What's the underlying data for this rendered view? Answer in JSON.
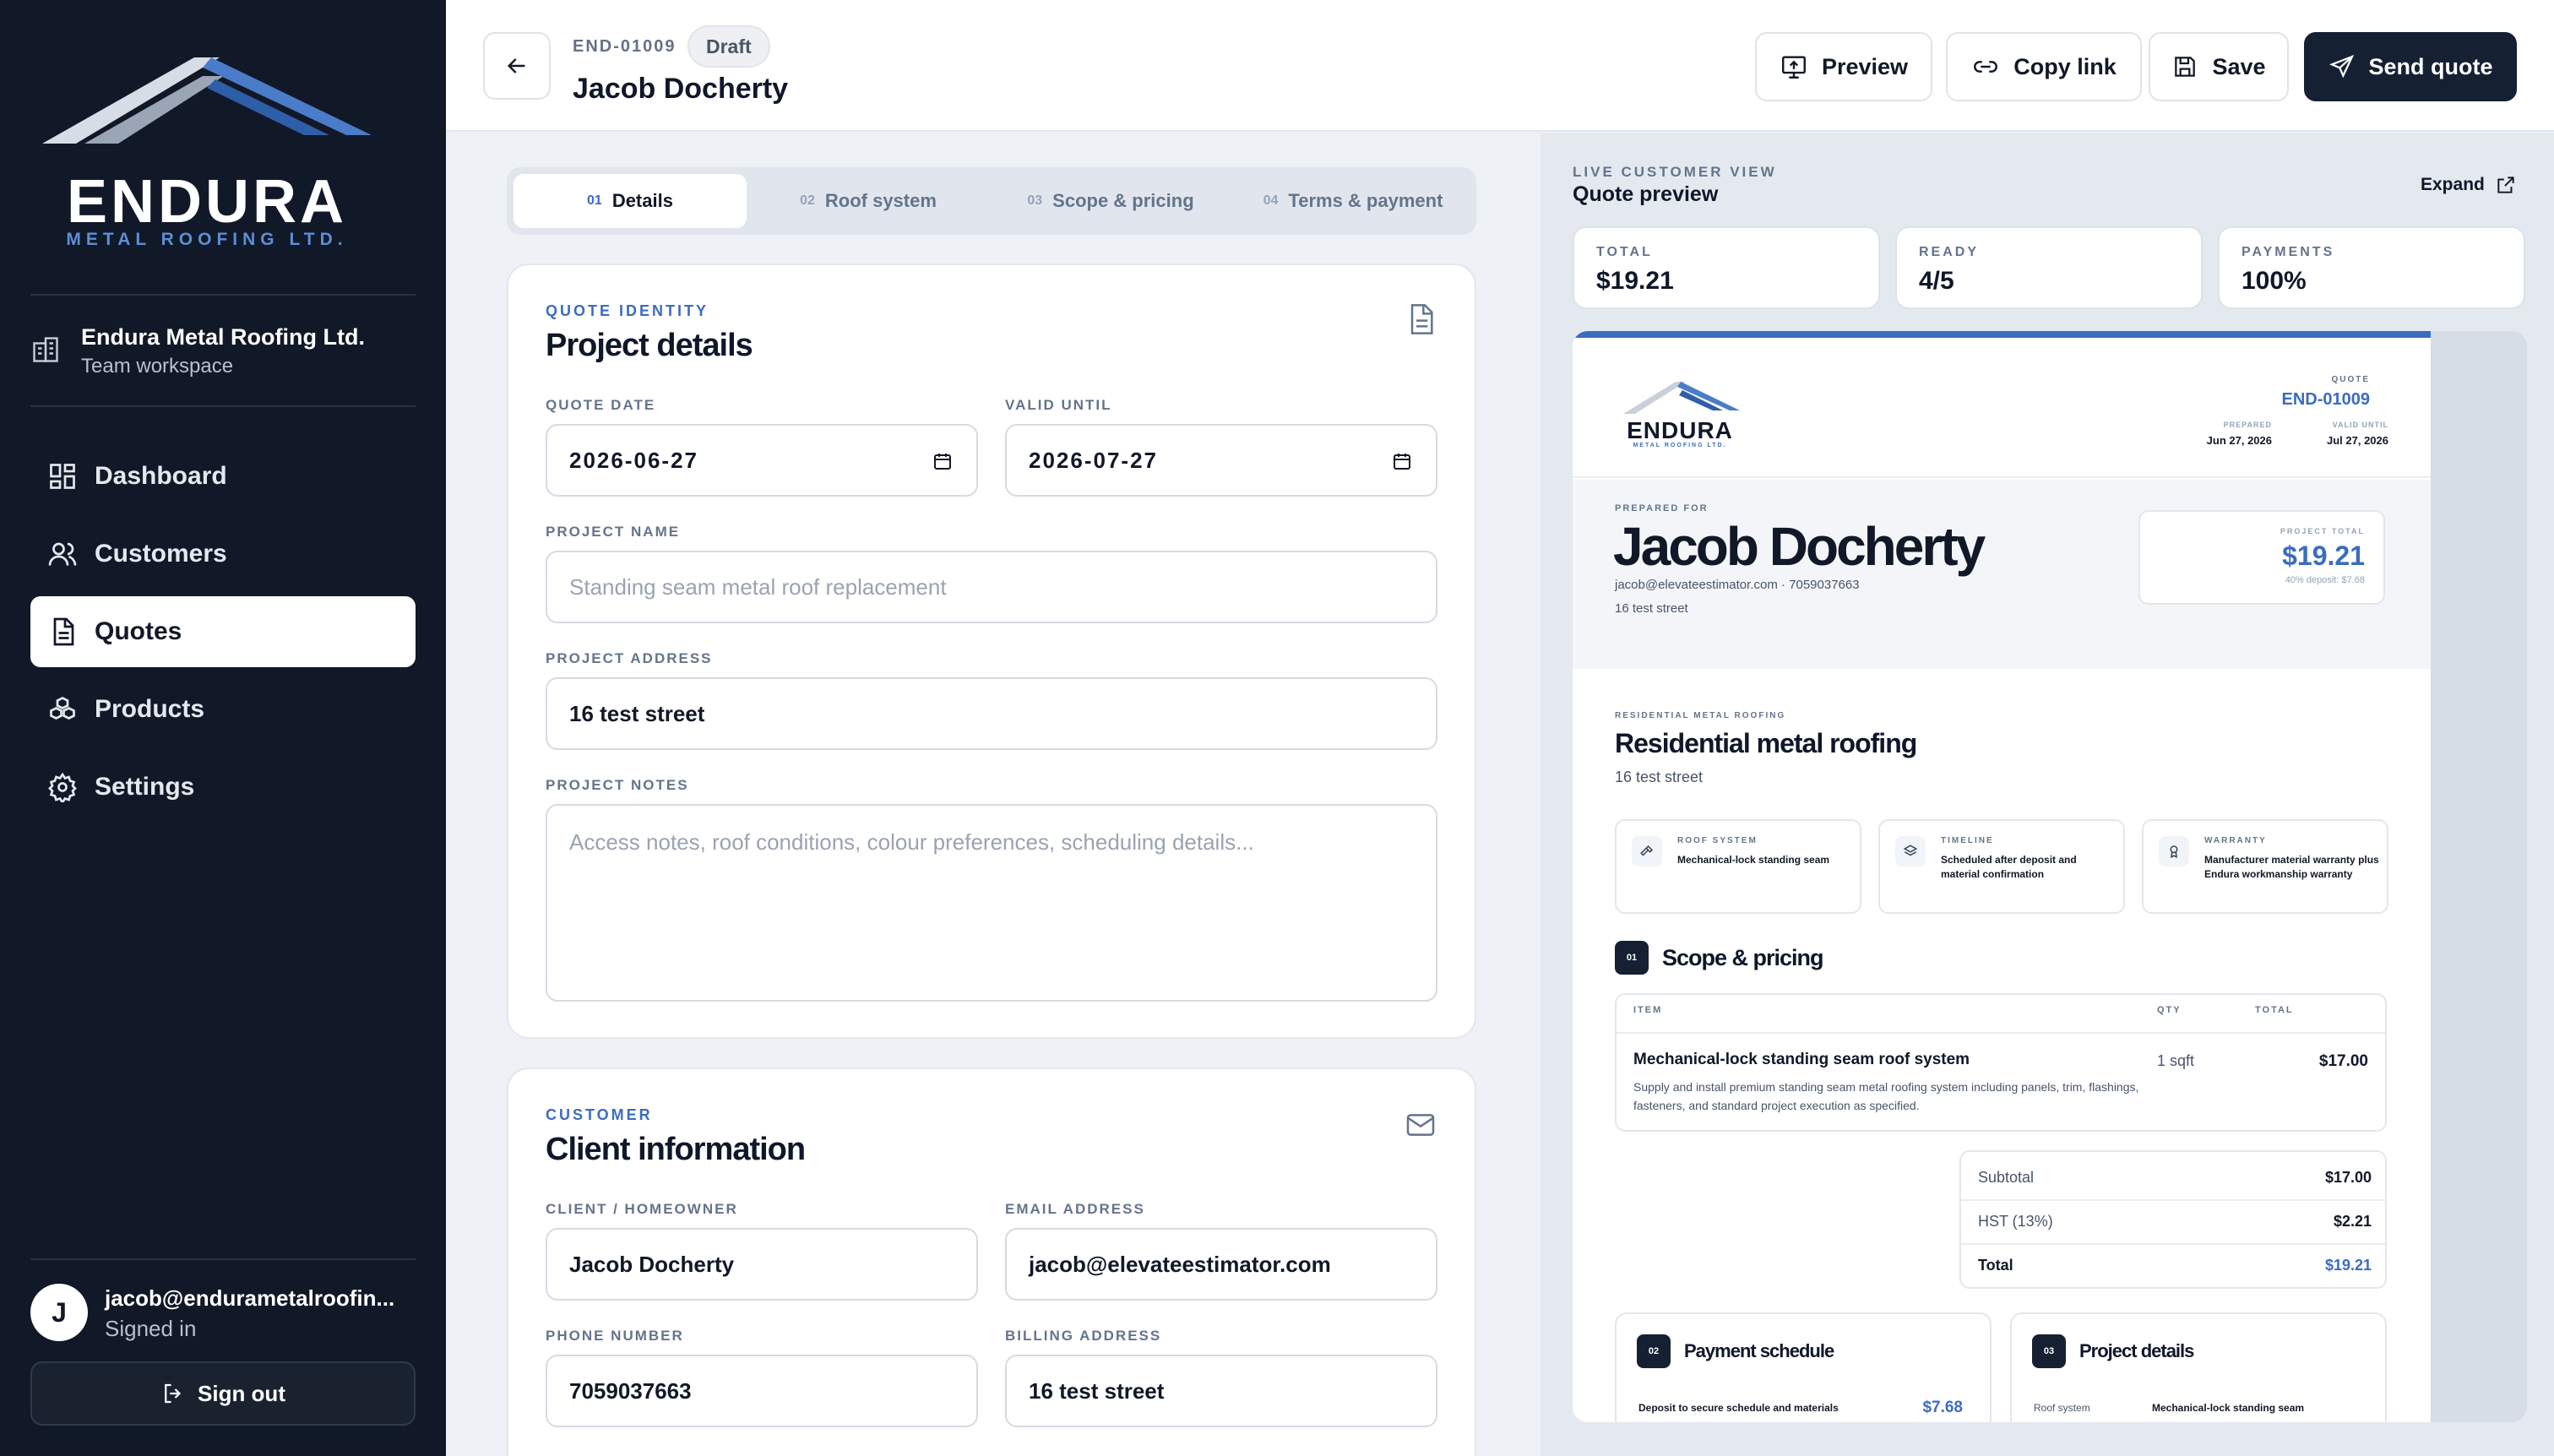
{
  "brand": {
    "name": "ENDURA",
    "sub": "METAL ROOFING LTD."
  },
  "workspace": {
    "name": "Endura Metal Roofing Ltd.",
    "sub": "Team workspace"
  },
  "nav": [
    {
      "label": "Dashboard",
      "icon": "grid-icon"
    },
    {
      "label": "Customers",
      "icon": "users-icon"
    },
    {
      "label": "Quotes",
      "icon": "file-icon",
      "active": true
    },
    {
      "label": "Products",
      "icon": "boxes-icon"
    },
    {
      "label": "Settings",
      "icon": "gear-icon"
    }
  ],
  "user": {
    "initial": "J",
    "email": "jacob@endurametalroofin...",
    "status": "Signed in",
    "signout": "Sign out"
  },
  "header": {
    "quote_id": "END-01009",
    "status": "Draft",
    "customer": "Jacob Docherty",
    "buttons": {
      "preview": "Preview",
      "copy_link": "Copy link",
      "save": "Save",
      "send": "Send quote"
    }
  },
  "tabs": [
    {
      "num": "01",
      "label": "Details",
      "active": true
    },
    {
      "num": "02",
      "label": "Roof system"
    },
    {
      "num": "03",
      "label": "Scope & pricing"
    },
    {
      "num": "04",
      "label": "Terms & payment"
    }
  ],
  "project": {
    "eyebrow": "QUOTE IDENTITY",
    "title": "Project details",
    "quote_date_label": "QUOTE DATE",
    "quote_date": "2026-06-27",
    "valid_until_label": "VALID UNTIL",
    "valid_until": "2026-07-27",
    "name_label": "PROJECT NAME",
    "name_placeholder": "Standing seam metal roof replacement",
    "address_label": "PROJECT ADDRESS",
    "address": "16 test street",
    "notes_label": "PROJECT NOTES",
    "notes_placeholder": "Access notes, roof conditions, colour preferences, scheduling details..."
  },
  "customer": {
    "eyebrow": "CUSTOMER",
    "title": "Client information",
    "client_label": "CLIENT / HOMEOWNER",
    "client": "Jacob Docherty",
    "email_label": "EMAIL ADDRESS",
    "email": "jacob@elevateestimator.com",
    "phone_label": "PHONE NUMBER",
    "phone": "7059037663",
    "billing_label": "BILLING ADDRESS",
    "billing": "16 test street"
  },
  "preview": {
    "eyebrow": "LIVE CUSTOMER VIEW",
    "title": "Quote preview",
    "expand": "Expand",
    "stats": [
      {
        "label": "TOTAL",
        "value": "$19.21"
      },
      {
        "label": "READY",
        "value": "4/5"
      },
      {
        "label": "PAYMENTS",
        "value": "100%"
      }
    ],
    "doc": {
      "logo_word": "ENDURA",
      "logo_sub": "METAL ROOFING LTD.",
      "quote_label": "QUOTE",
      "quote_id": "END-01009",
      "prepared_label": "PREPARED",
      "prepared": "Jun 27, 2026",
      "valid_label": "VALID UNTIL",
      "valid": "Jul 27, 2026",
      "prepared_for": "PREPARED FOR",
      "name": "Jacob Docherty",
      "contact": "jacob@elevateestimator.com · 7059037663",
      "address": "16 test street",
      "project_total_label": "PROJECT TOTAL",
      "project_total": "$19.21",
      "deposit_note": "40% deposit: $7.68",
      "section_eyebrow": "RESIDENTIAL METAL ROOFING",
      "section_title": "Residential metal roofing",
      "section_address": "16 test street",
      "cards": [
        {
          "label": "ROOF SYSTEM",
          "value": "Mechanical-lock standing seam",
          "icon": "hammer-icon"
        },
        {
          "label": "TIMELINE",
          "value": "Scheduled after deposit and material confirmation",
          "icon": "layers-icon"
        },
        {
          "label": "WARRANTY",
          "value": "Manufacturer material warranty plus Endura workmanship warranty",
          "icon": "award-icon"
        }
      ],
      "scope": {
        "num": "01",
        "title": "Scope & pricing",
        "h_item": "ITEM",
        "h_qty": "QTY",
        "h_total": "TOTAL",
        "item_name": "Mechanical-lock standing seam roof system",
        "item_desc": "Supply and install premium standing seam metal roofing system including panels, trim, flashings, fasteners, and standard project execution as specified.",
        "item_qty": "1 sqft",
        "item_total": "$17.00"
      },
      "totals": {
        "subtotal_label": "Subtotal",
        "subtotal": "$17.00",
        "hst_label": "HST (13%)",
        "hst": "$2.21",
        "total_label": "Total",
        "total": "$19.21"
      },
      "payment": {
        "num": "02",
        "title": "Payment schedule",
        "row": "Deposit to secure schedule and materials",
        "amount": "$7.68"
      },
      "details": {
        "num": "03",
        "title": "Project details",
        "key": "Roof system",
        "value": "Mechanical-lock standing seam"
      }
    }
  },
  "colors": {
    "sidebar": "#111827",
    "accent": "#3b6cc0",
    "primary_button": "#152033"
  }
}
